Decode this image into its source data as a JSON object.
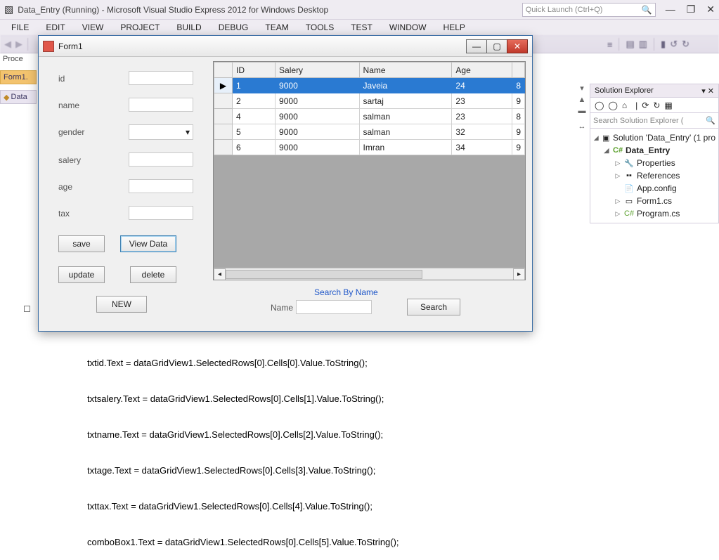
{
  "vs": {
    "title": "Data_Entry (Running) - Microsoft Visual Studio Express 2012 for Windows Desktop",
    "quick_launch_placeholder": "Quick Launch (Ctrl+Q)",
    "menu": [
      "FILE",
      "EDIT",
      "VIEW",
      "PROJECT",
      "BUILD",
      "DEBUG",
      "TEAM",
      "TOOLS",
      "TEST",
      "WINDOW",
      "HELP"
    ],
    "left_label": "Proce",
    "left_tab_active": "Form1.",
    "left_tab2": "Data"
  },
  "solution_explorer": {
    "title": "Solution Explorer",
    "search_placeholder": "Search Solution Explorer (",
    "solution_line": "Solution 'Data_Entry' (1 pro",
    "project": "Data_Entry",
    "items": [
      "Properties",
      "References",
      "App.config",
      "Form1.cs",
      "Program.cs"
    ]
  },
  "form1": {
    "title": "Form1",
    "labels": {
      "id": "id",
      "name": "name",
      "gender": "gender",
      "salery": "salery",
      "age": "age",
      "tax": "tax"
    },
    "buttons": {
      "save": "save",
      "view": "View Data",
      "update": "update",
      "delete": "delete",
      "new": "NEW",
      "search": "Search"
    },
    "search_heading": "Search By Name",
    "search_label": "Name",
    "grid": {
      "columns": [
        "ID",
        "Salery",
        "Name",
        "Age"
      ],
      "rows": [
        {
          "id": "1",
          "salery": "9000",
          "name": "Javeia",
          "age": "24"
        },
        {
          "id": "2",
          "salery": "9000",
          "name": "sartaj",
          "age": "23"
        },
        {
          "id": "4",
          "salery": "9000",
          "name": "salman",
          "age": "23"
        },
        {
          "id": "5",
          "salery": "9000",
          "name": "salman",
          "age": "32"
        },
        {
          "id": "6",
          "salery": "9000",
          "name": "Imran",
          "age": "34"
        }
      ],
      "last_col_fragments": [
        "8",
        "9",
        "8",
        "9",
        "9"
      ]
    }
  },
  "code": {
    "lines": [
      "txtid.Text = dataGridView1.SelectedRows[0].Cells[0].Value.ToString();",
      "txtsalery.Text = dataGridView1.SelectedRows[0].Cells[1].Value.ToString();",
      "txtname.Text = dataGridView1.SelectedRows[0].Cells[2].Value.ToString();",
      "txtage.Text = dataGridView1.SelectedRows[0].Cells[3].Value.ToString();",
      "txttax.Text = dataGridView1.SelectedRows[0].Cells[4].Value.ToString();",
      "comboBox1.Text = dataGridView1.SelectedRows[0].Cells[5].Value.ToString();"
    ]
  }
}
